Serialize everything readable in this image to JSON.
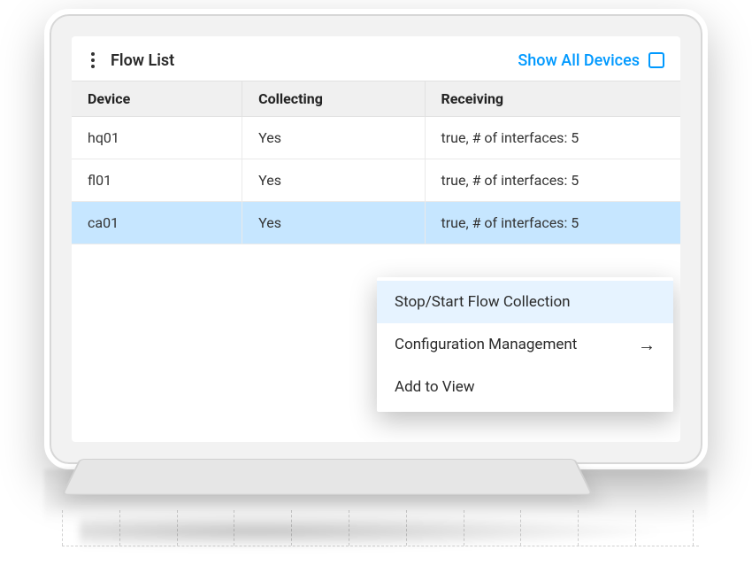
{
  "header": {
    "title": "Flow List",
    "show_all_label": "Show All Devices"
  },
  "columns": {
    "device": "Device",
    "collecting": "Collecting",
    "receiving": "Receiving"
  },
  "rows": [
    {
      "device": "hq01",
      "collecting": "Yes",
      "receiving": "true, # of interfaces: 5",
      "selected": false
    },
    {
      "device": "fl01",
      "collecting": "Yes",
      "receiving": "true, # of interfaces: 5",
      "selected": false
    },
    {
      "device": "ca01",
      "collecting": "Yes",
      "receiving": "true, # of interfaces: 5",
      "selected": true
    }
  ],
  "context_menu": {
    "items": [
      {
        "label": "Stop/Start Flow Collection",
        "submenu": false,
        "highlighted": true
      },
      {
        "label": "Configuration Management",
        "submenu": true,
        "highlighted": false
      },
      {
        "label": "Add to View",
        "submenu": false,
        "highlighted": false
      }
    ]
  },
  "colors": {
    "accent": "#0099ff",
    "row_selected": "#c6e6ff",
    "menu_highlight": "#e6f3ff"
  }
}
